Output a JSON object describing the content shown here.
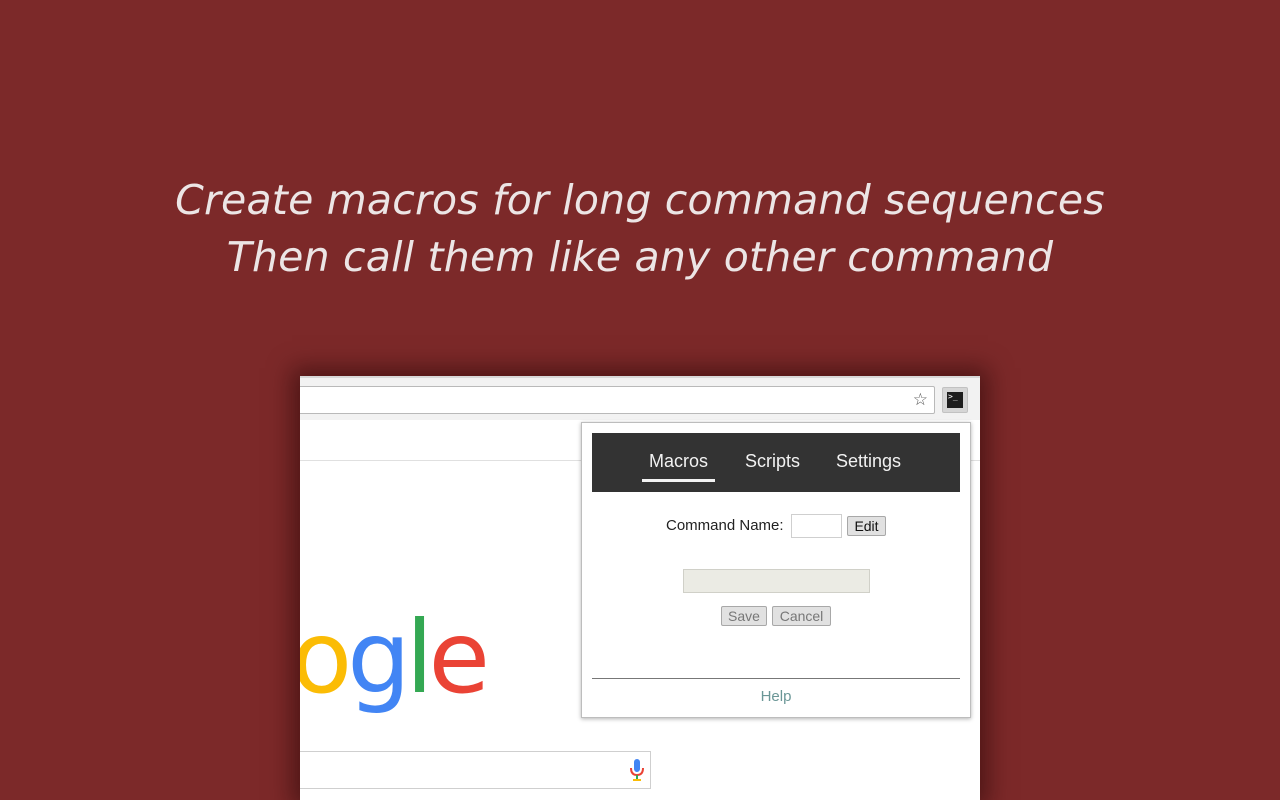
{
  "headline": {
    "line1": "Create macros for long command sequences",
    "line2": "Then call them like any other command"
  },
  "colors": {
    "background": "#7c2929",
    "headline_text": "#ece5e5",
    "popup_header": "#333333",
    "help_link": "#6b9797"
  },
  "browser": {
    "star_icon": "star-outline-icon",
    "extension_icon": "terminal-icon",
    "google_logo_visible": "ogle",
    "mic_icon": "microphone-icon"
  },
  "popup": {
    "tabs": [
      {
        "label": "Macros",
        "active": true
      },
      {
        "label": "Scripts",
        "active": false
      },
      {
        "label": "Settings",
        "active": false
      }
    ],
    "command_name_label": "Command Name:",
    "command_name_value": "",
    "edit_button": "Edit",
    "save_button": "Save",
    "cancel_button": "Cancel",
    "help_link": "Help"
  }
}
